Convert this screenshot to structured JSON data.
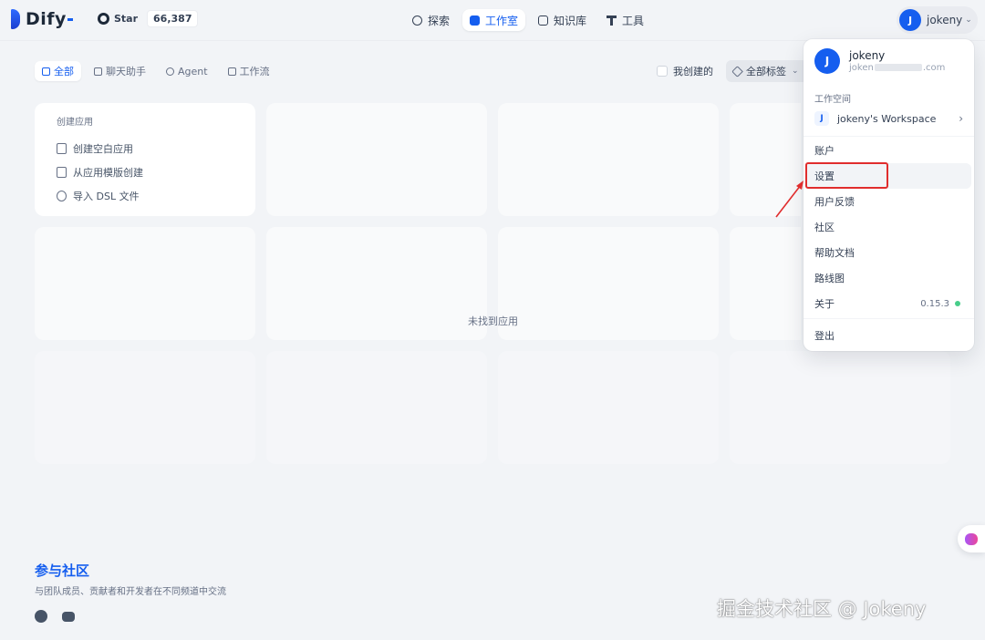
{
  "header": {
    "logo_text": "Dify",
    "star_label": "Star",
    "star_count": "66,387",
    "nav": [
      {
        "label": "探索",
        "icon": "compass-icon"
      },
      {
        "label": "工作室",
        "icon": "robot-icon",
        "active": true
      },
      {
        "label": "知识库",
        "icon": "book-icon"
      },
      {
        "label": "工具",
        "icon": "hammer-icon"
      }
    ],
    "user_initial": "J",
    "user_name": "jokeny"
  },
  "filters": {
    "tabs": [
      {
        "label": "全部",
        "active": true
      },
      {
        "label": "聊天助手"
      },
      {
        "label": "Agent"
      },
      {
        "label": "工作流"
      }
    ],
    "mine_label": "我创建的",
    "tags_label": "全部标签"
  },
  "create_card": {
    "title": "创建应用",
    "items": [
      "创建空白应用",
      "从应用模版创建",
      "导入 DSL 文件"
    ]
  },
  "empty_text": "未找到应用",
  "community": {
    "title": "参与社区",
    "subtitle": "与团队成员、贡献者和开发者在不同频道中交流"
  },
  "dropdown": {
    "user_initial": "J",
    "user_name": "jokeny",
    "user_email_start": "joken",
    "user_email_end": ".com",
    "workspace_label": "工作空间",
    "workspace_initial": "J",
    "workspace_name": "jokeny's Workspace",
    "items": {
      "account": "账户",
      "settings": "设置",
      "feedback": "用户反馈",
      "community": "社区",
      "docs": "帮助文档",
      "roadmap": "路线图",
      "about": "关于",
      "logout": "登出"
    },
    "version": "0.15.3"
  },
  "colors": {
    "accent": "#155eef",
    "highlight": "#e02d2d",
    "status_ok": "#47cd89"
  },
  "watermark": "掘金技术社区 @ Jokeny"
}
